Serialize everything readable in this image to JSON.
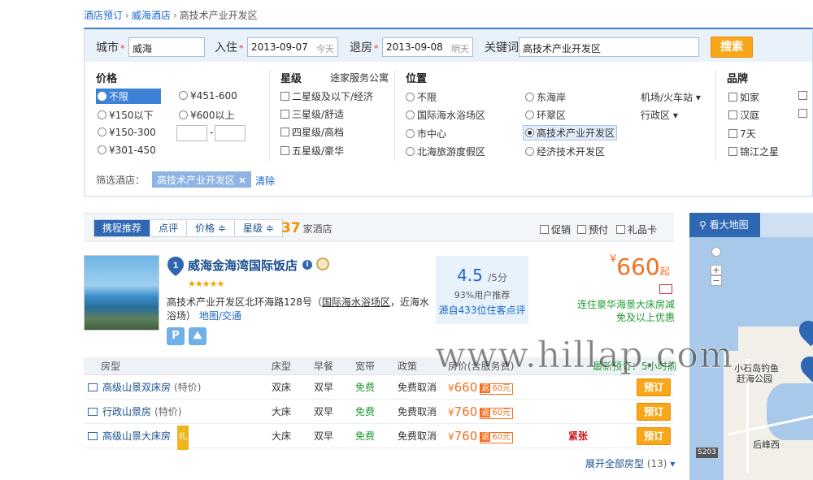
{
  "breadcrumb": {
    "home": "酒店预订",
    "sep1": "›",
    "city": "威海酒店",
    "sep2": "›",
    "current": "高技术产业开发区"
  },
  "search": {
    "city_label": "城市",
    "req": "*",
    "city_value": "威海",
    "checkin_label": "入住",
    "checkin_value": "2013-09-07",
    "checkin_hint": "今天",
    "checkout_label": "退房",
    "checkout_value": "2013-09-08",
    "checkout_hint": "明天",
    "keyword_label": "关键词",
    "keyword_value": "高技术产业开发区",
    "search_button": "搜索"
  },
  "filters": {
    "price": {
      "title": "价格",
      "options": [
        "不限",
        "¥150以下",
        "¥150-300",
        "¥301-450",
        "¥451-600",
        "¥600以上"
      ],
      "range_sep": "-"
    },
    "star": {
      "title": "星级",
      "chain_link": "途家服务公寓",
      "options": [
        "二星级及以下/经济",
        "三星级/舒适",
        "四星级/高档",
        "五星级/豪华"
      ]
    },
    "location": {
      "title": "位置",
      "options": [
        "不限",
        "国际海水浴场区",
        "市中心",
        "北海旅游度假区",
        "东海岸",
        "环翠区",
        "高技术产业开发区",
        "经济技术开发区"
      ],
      "links": [
        "机场/火车站",
        "行政区"
      ]
    },
    "brand": {
      "title": "品牌",
      "options": [
        "如家",
        "汉庭",
        "7天",
        "锦江之星"
      ]
    }
  },
  "active_filter": {
    "label": "筛选酒店：",
    "tag": "高技术产业开发区",
    "tag_close": "×",
    "clear": "清除"
  },
  "sort": {
    "tabs": [
      "携程推荐",
      "点评",
      "价格 ≑",
      "星级 ≑"
    ],
    "count": "37",
    "count_suffix": "家酒店",
    "checks": [
      "促销",
      "预付",
      "礼品卡"
    ]
  },
  "hotel": {
    "index": "1",
    "name": "威海金海湾国际饭店",
    "stars": "★★★★★",
    "address_pre": "高技术产业开发区北环海路128号（",
    "address_link": "国际海水浴场区",
    "address_post": "，近海水浴场）",
    "map_link": "地图/交通",
    "rating": "4.5",
    "rating_unit": "/5分",
    "recommend": "93%用户推荐",
    "source": "源自433位住客点评",
    "price_currency": "¥",
    "price": "660",
    "price_suffix": "起",
    "promo": "连住豪华海景大床房减免及以上优惠"
  },
  "rooms": {
    "headers": [
      "房型",
      "床型",
      "早餐",
      "宽带",
      "政策",
      "房价(含服务费)",
      "最新预订：5小时前"
    ],
    "rows": [
      {
        "name": "高级山景双床房",
        "tag": "(特价)",
        "bed": "双床",
        "breakfast": "双早",
        "broadband": "免费",
        "policy": "免费取消",
        "currency": "¥",
        "price": "660",
        "fan1": "返",
        "fan2": "60元",
        "status": "",
        "book": "预订"
      },
      {
        "name": "行政山景房",
        "tag": "(特价)",
        "bed": "大床",
        "breakfast": "双早",
        "broadband": "免费",
        "policy": "免费取消",
        "currency": "¥",
        "price": "760",
        "fan1": "返",
        "fan2": "60元",
        "status": "",
        "book": "预订"
      },
      {
        "name": "高级山景大床房",
        "tag": "礼",
        "bed": "大床",
        "breakfast": "双早",
        "broadband": "免费",
        "policy": "免费取消",
        "currency": "¥",
        "price": "760",
        "fan1": "返",
        "fan2": "60元",
        "status": "紧张",
        "book": "预订"
      }
    ],
    "expand": "展开全部房型",
    "expand_count": "(13)"
  },
  "map": {
    "button": "看大地图",
    "labels": [
      "小石岛钓鱼",
      "赶海公园",
      "后峰西",
      "S203"
    ],
    "zoom_in": "+",
    "zoom_out": "−"
  },
  "watermark": "www.hillap.com",
  "colors": {
    "accent": "#2f67b3",
    "button": "#f9a71a",
    "price": "#f37021",
    "promo": "#1d9b2f"
  }
}
